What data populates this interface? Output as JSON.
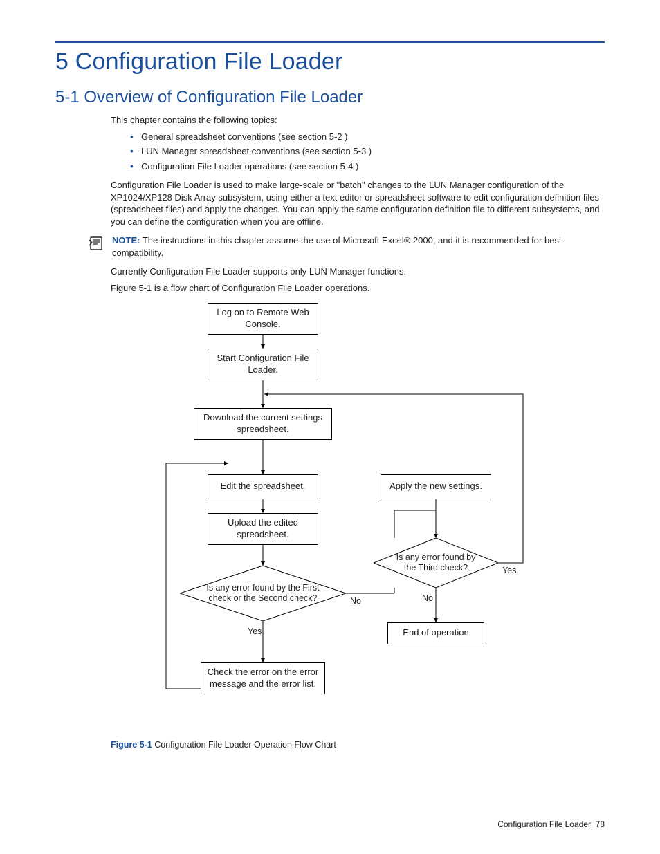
{
  "chapter_title": "5 Configuration File Loader",
  "section_title": "5-1 Overview of Configuration File Loader",
  "intro": "This chapter contains the following topics:",
  "topics": [
    "General spreadsheet conventions (see section 5-2 )",
    "LUN Manager spreadsheet conventions (see section 5-3 )",
    "Configuration File Loader operations (see section 5-4 )"
  ],
  "para_config": "Configuration File Loader is used to make large-scale or \"batch\" changes to the LUN Manager configuration of the XP1024/XP128 Disk Array subsystem, using either a text editor or spreadsheet software to edit configuration definition files (spreadsheet files) and apply the changes. You can apply the same configuration definition file to different subsystems, and you can define the configuration when you are offline.",
  "note_label": "NOTE:",
  "note_text": " The instructions in this chapter assume the use of Microsoft Excel® 2000, and it is recommended for best compatibility.",
  "para_currently": "Currently Configuration File Loader supports only LUN Manager functions.",
  "para_figref": "Figure 5-1 is a flow chart of Configuration File Loader operations.",
  "flow": {
    "step1": "Log on to Remote Web Console.",
    "step2": "Start Configuration File Loader.",
    "step3": "Download the current settings spreadsheet.",
    "step4": "Edit the spreadsheet.",
    "step5": "Upload the edited spreadsheet.",
    "dec1": "Is any error found by the First check or the Second check?",
    "dec1_no": "No",
    "dec1_yes": "Yes",
    "step_err": "Check the error on the error message and the error list.",
    "apply": "Apply the new settings.",
    "dec2": "Is any error found by the Third check?",
    "dec2_no": "No",
    "dec2_yes": "Yes",
    "end": "End of operation"
  },
  "figure_label": "Figure 5-1",
  "figure_caption": " Configuration File Loader Operation Flow Chart",
  "footer_title": "Configuration File Loader",
  "footer_page": "78"
}
